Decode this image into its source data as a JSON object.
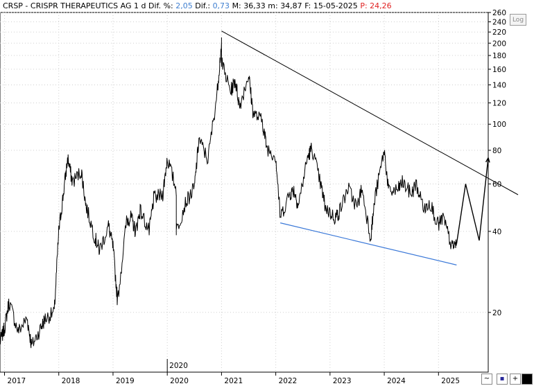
{
  "header": {
    "ticker": "CRSP - CRISPR THERAPEUTICS AG",
    "interval": "1 d",
    "dif_pct_label": "Dif. %:",
    "dif_pct_value": "2,05",
    "dif_label": "Dif.:",
    "dif_value": "0,73",
    "max_label": "M:",
    "max_value": "36,33",
    "min_label": "m:",
    "min_value": "34,87",
    "date_label": "F:",
    "date_value": "15-05-2025",
    "price_label": "P:",
    "price_value": "24,26"
  },
  "controls": {
    "log_label": "Log"
  },
  "colors": {
    "price": "#000000",
    "resistance_line": "#000000",
    "support_line": "#3a78d8",
    "grid": "#cfcfcf",
    "header_value": "#3f7fd0",
    "header_price": "#e02020"
  },
  "chart_data": {
    "type": "line",
    "scale": "log",
    "ylim": [
      12,
      260
    ],
    "xlim": [
      "2016-12",
      "2025-12"
    ],
    "grid": true,
    "y_ticks": [
      260,
      240,
      220,
      200,
      180,
      160,
      140,
      120,
      100,
      80,
      60,
      40,
      20
    ],
    "x_ticks": [
      "2017",
      "2018",
      "2019",
      "2020",
      "2021",
      "2022",
      "2023",
      "2024",
      "2025"
    ],
    "year_marker_label": "2020",
    "series": [
      {
        "x": [
          "2016-12",
          "2017-01",
          "2017-02",
          "2017-04",
          "2017-06",
          "2017-07",
          "2017-09",
          "2017-10",
          "2017-12",
          "2018-01",
          "2018-02",
          "2018-03",
          "2018-04",
          "2018-06",
          "2018-07",
          "2018-09",
          "2018-10",
          "2018-12",
          "2019-01",
          "2019-02",
          "2019-04",
          "2019-05",
          "2019-06",
          "2019-07",
          "2019-09",
          "2019-10",
          "2019-12",
          "2020-01",
          "2020-03",
          "2020-03",
          "2020-05",
          "2020-07",
          "2020-08",
          "2020-10",
          "2020-12",
          "2021-01",
          "2021-01",
          "2021-03",
          "2021-04",
          "2021-05",
          "2021-07",
          "2021-08",
          "2021-10",
          "2021-11",
          "2022-01",
          "2022-02",
          "2022-04",
          "2022-05",
          "2022-06",
          "2022-08",
          "2022-09",
          "2022-11",
          "2022-12",
          "2023-02",
          "2023-03",
          "2023-05",
          "2023-07",
          "2023-08",
          "2023-10",
          "2023-11",
          "2024-01",
          "2024-02",
          "2024-04",
          "2024-05",
          "2024-07",
          "2024-08",
          "2024-10",
          "2024-11",
          "2025-01",
          "2025-02",
          "2025-04",
          "2025-05"
        ],
        "y": [
          15.5,
          17.5,
          22,
          17,
          19,
          15,
          17.5,
          19,
          20,
          40,
          55,
          75,
          61,
          67,
          50,
          38,
          34,
          42,
          35,
          22,
          44,
          45,
          40,
          48,
          40,
          53,
          55,
          75,
          57,
          40,
          51,
          58,
          88,
          74,
          130,
          200,
          170,
          132,
          146,
          117,
          153,
          110,
          103,
          82,
          76,
          45,
          55,
          57,
          50,
          75,
          82,
          59,
          49,
          45,
          47,
          58,
          49,
          58,
          38,
          54,
          80,
          56,
          57,
          61,
          55,
          60,
          48,
          52,
          42,
          45,
          35,
          36
        ]
      }
    ],
    "annotations": [
      {
        "type": "trendline",
        "from": [
          "2021-01",
          222
        ],
        "to": [
          "2025-12",
          48
        ]
      },
      {
        "type": "support_line",
        "from": [
          "2022-02",
          43
        ],
        "to": [
          "2025-05",
          30
        ]
      },
      {
        "type": "projection",
        "points": [
          [
            "2025-05",
            36
          ],
          [
            "2025-07",
            60
          ],
          [
            "2025-10",
            37
          ],
          [
            "2025-12",
            75
          ]
        ]
      }
    ]
  }
}
